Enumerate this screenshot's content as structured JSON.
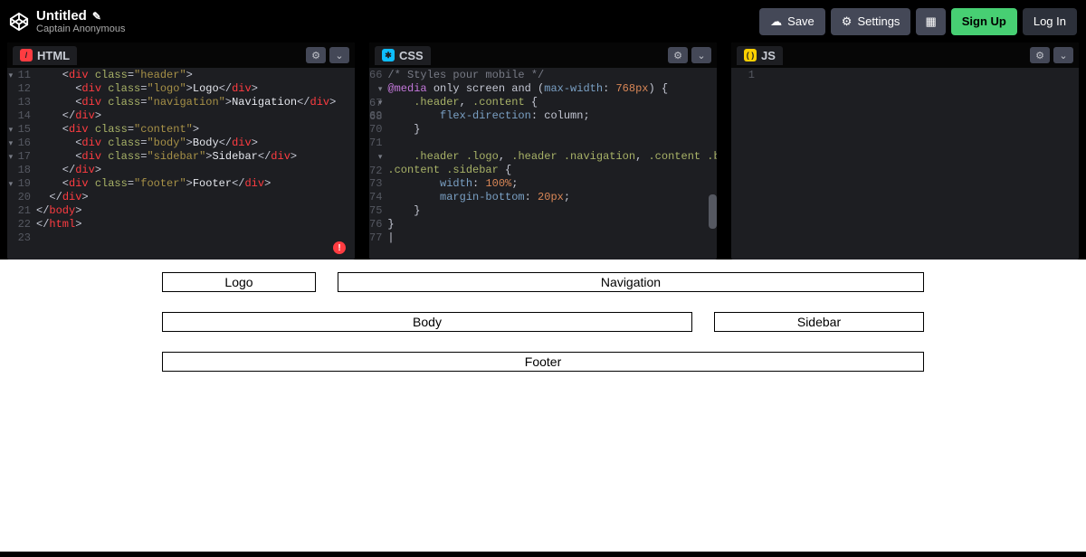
{
  "header": {
    "title": "Untitled",
    "subtitle": "Captain Anonymous",
    "buttons": {
      "save": "Save",
      "settings": "Settings",
      "signup": "Sign Up",
      "login": "Log In"
    }
  },
  "panes": {
    "html": {
      "label": "HTML"
    },
    "css": {
      "label": "CSS"
    },
    "js": {
      "label": "JS"
    }
  },
  "html_code": {
    "lines": [
      "11",
      "12",
      "13",
      "14",
      "15",
      "16",
      "17",
      "18",
      "19",
      "20",
      "21",
      "22",
      "23"
    ],
    "r11_a": "    <",
    "r11_b": "div ",
    "r11_c": "class",
    "r11_d": "=",
    "r11_e": "\"header\"",
    "r11_f": ">",
    "r12_a": "      <",
    "r12_b": "div ",
    "r12_c": "class",
    "r12_d": "=",
    "r12_e": "\"logo\"",
    "r12_f": ">",
    "r12_g": "Logo",
    "r12_h": "</",
    "r12_i": "div",
    "r12_j": ">",
    "r13_a": "      <",
    "r13_b": "div ",
    "r13_c": "class",
    "r13_d": "=",
    "r13_e": "\"navigation\"",
    "r13_f": ">",
    "r13_g": "Navigation",
    "r13_h": "</",
    "r13_i": "div",
    "r13_j": ">",
    "r14_a": "    </",
    "r14_b": "div",
    "r14_c": ">",
    "r15_a": "    <",
    "r15_b": "div ",
    "r15_c": "class",
    "r15_d": "=",
    "r15_e": "\"content\"",
    "r15_f": ">",
    "r16_a": "      <",
    "r16_b": "div ",
    "r16_c": "class",
    "r16_d": "=",
    "r16_e": "\"body\"",
    "r16_f": ">",
    "r16_g": "Body",
    "r16_h": "</",
    "r16_i": "div",
    "r16_j": ">",
    "r17_a": "      <",
    "r17_b": "div ",
    "r17_c": "class",
    "r17_d": "=",
    "r17_e": "\"sidebar\"",
    "r17_f": ">",
    "r17_g": "Sidebar",
    "r17_h": "</",
    "r17_i": "div",
    "r17_j": ">",
    "r18_a": "    </",
    "r18_b": "div",
    "r18_c": ">",
    "r19_a": "    <",
    "r19_b": "div ",
    "r19_c": "class",
    "r19_d": "=",
    "r19_e": "\"footer\"",
    "r19_f": ">",
    "r19_g": "Footer",
    "r19_h": "</",
    "r19_i": "div",
    "r19_j": ">",
    "r20_a": "  </",
    "r20_b": "div",
    "r20_c": ">",
    "r21_a": "</",
    "r21_b": "body",
    "r21_c": ">",
    "r22_a": "</",
    "r22_b": "html",
    "r22_c": ">"
  },
  "css_code": {
    "lines": [
      "66",
      "67",
      "68",
      "69",
      "70",
      "71",
      "72",
      "",
      "73",
      "74",
      "75",
      "76",
      "77"
    ],
    "r66": "/* Styles pour mobile */",
    "r67_a": "@media",
    "r67_b": " only screen and ",
    "r67_c": "(",
    "r67_d": "max-width",
    "r67_e": ": ",
    "r67_f": "768px",
    "r67_g": ") {",
    "r68_a": "    ",
    "r68_b": ".header",
    "r68_c": ", ",
    "r68_d": ".content",
    "r68_e": " {",
    "r69_a": "        ",
    "r69_b": "flex-direction",
    "r69_c": ": column;",
    "r70": "    }",
    "r72_a": "    ",
    "r72_b": ".header .logo",
    "r72_c": ", ",
    "r72_d": ".header .navigation",
    "r72_e": ", ",
    "r72_f": ".content .body",
    "r72_g": ",",
    "r72x_a": ".content .sidebar",
    "r72x_b": " {",
    "r73_a": "        ",
    "r73_b": "width",
    "r73_c": ": ",
    "r73_d": "100%",
    "r73_e": ";",
    "r74_a": "        ",
    "r74_b": "margin-bottom",
    "r74_c": ": ",
    "r74_d": "20px",
    "r74_e": ";",
    "r75": "    }",
    "r76": "}",
    "r77": "|"
  },
  "js_code": {
    "lines": [
      "1"
    ]
  },
  "preview": {
    "logo": "Logo",
    "navigation": "Navigation",
    "body": "Body",
    "sidebar": "Sidebar",
    "footer": "Footer"
  },
  "error": "!"
}
